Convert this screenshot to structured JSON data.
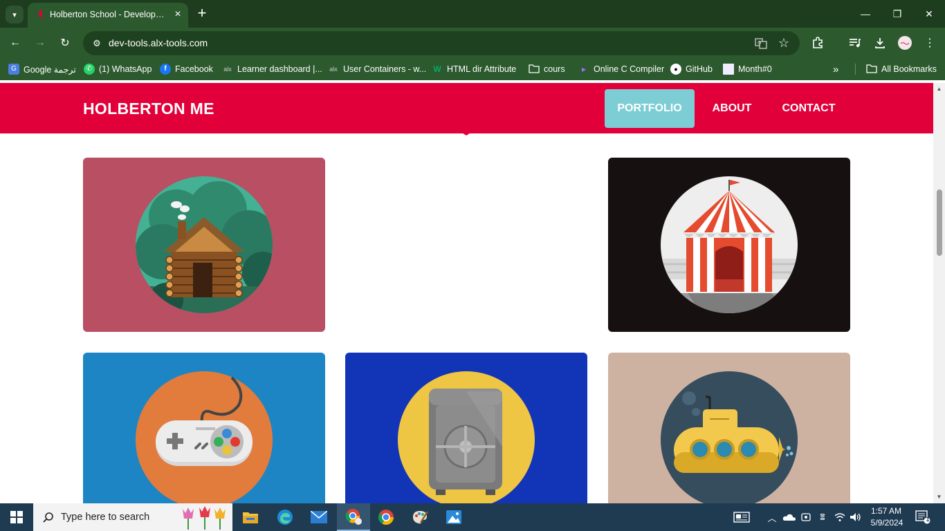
{
  "browser": {
    "tab_title": "Holberton School - Developer to",
    "url": "dev-tools.alx-tools.com",
    "bookmarks": [
      {
        "label": "Google ترجمة",
        "icon": "google-translate-icon"
      },
      {
        "label": "(1) WhatsApp",
        "icon": "whatsapp-icon"
      },
      {
        "label": "Facebook",
        "icon": "facebook-icon"
      },
      {
        "label": "Learner dashboard |...",
        "icon": "alx-icon"
      },
      {
        "label": "User Containers - w...",
        "icon": "alx-icon"
      },
      {
        "label": "HTML dir Attribute",
        "icon": "w3schools-icon"
      },
      {
        "label": "cours",
        "icon": "folder-icon"
      },
      {
        "label": "Online C Compiler",
        "icon": "compiler-icon"
      },
      {
        "label": "GitHub",
        "icon": "github-icon"
      },
      {
        "label": "Month#0",
        "icon": "page-icon"
      }
    ],
    "all_bookmarks_label": "All Bookmarks"
  },
  "site": {
    "brand": "HOLBERTON ME",
    "nav": {
      "portfolio": "PORTFOLIO",
      "about": "ABOUT",
      "contact": "CONTACT"
    },
    "colors": {
      "header": "#e1003a",
      "active_nav": "#7dcdd4"
    },
    "cards": [
      {
        "name": "cabin",
        "bg": "#b84f63"
      },
      {
        "name": "empty",
        "bg": "#ffffff"
      },
      {
        "name": "circus-tent",
        "bg": "#161110"
      },
      {
        "name": "game-controller",
        "bg": "#1e85c4"
      },
      {
        "name": "safe",
        "bg": "#1235b8"
      },
      {
        "name": "submarine",
        "bg": "#cdb2a2"
      }
    ]
  },
  "taskbar": {
    "search_placeholder": "Type here to search",
    "time": "1:57 AM",
    "date": "5/9/2024",
    "notification_count": "1"
  }
}
